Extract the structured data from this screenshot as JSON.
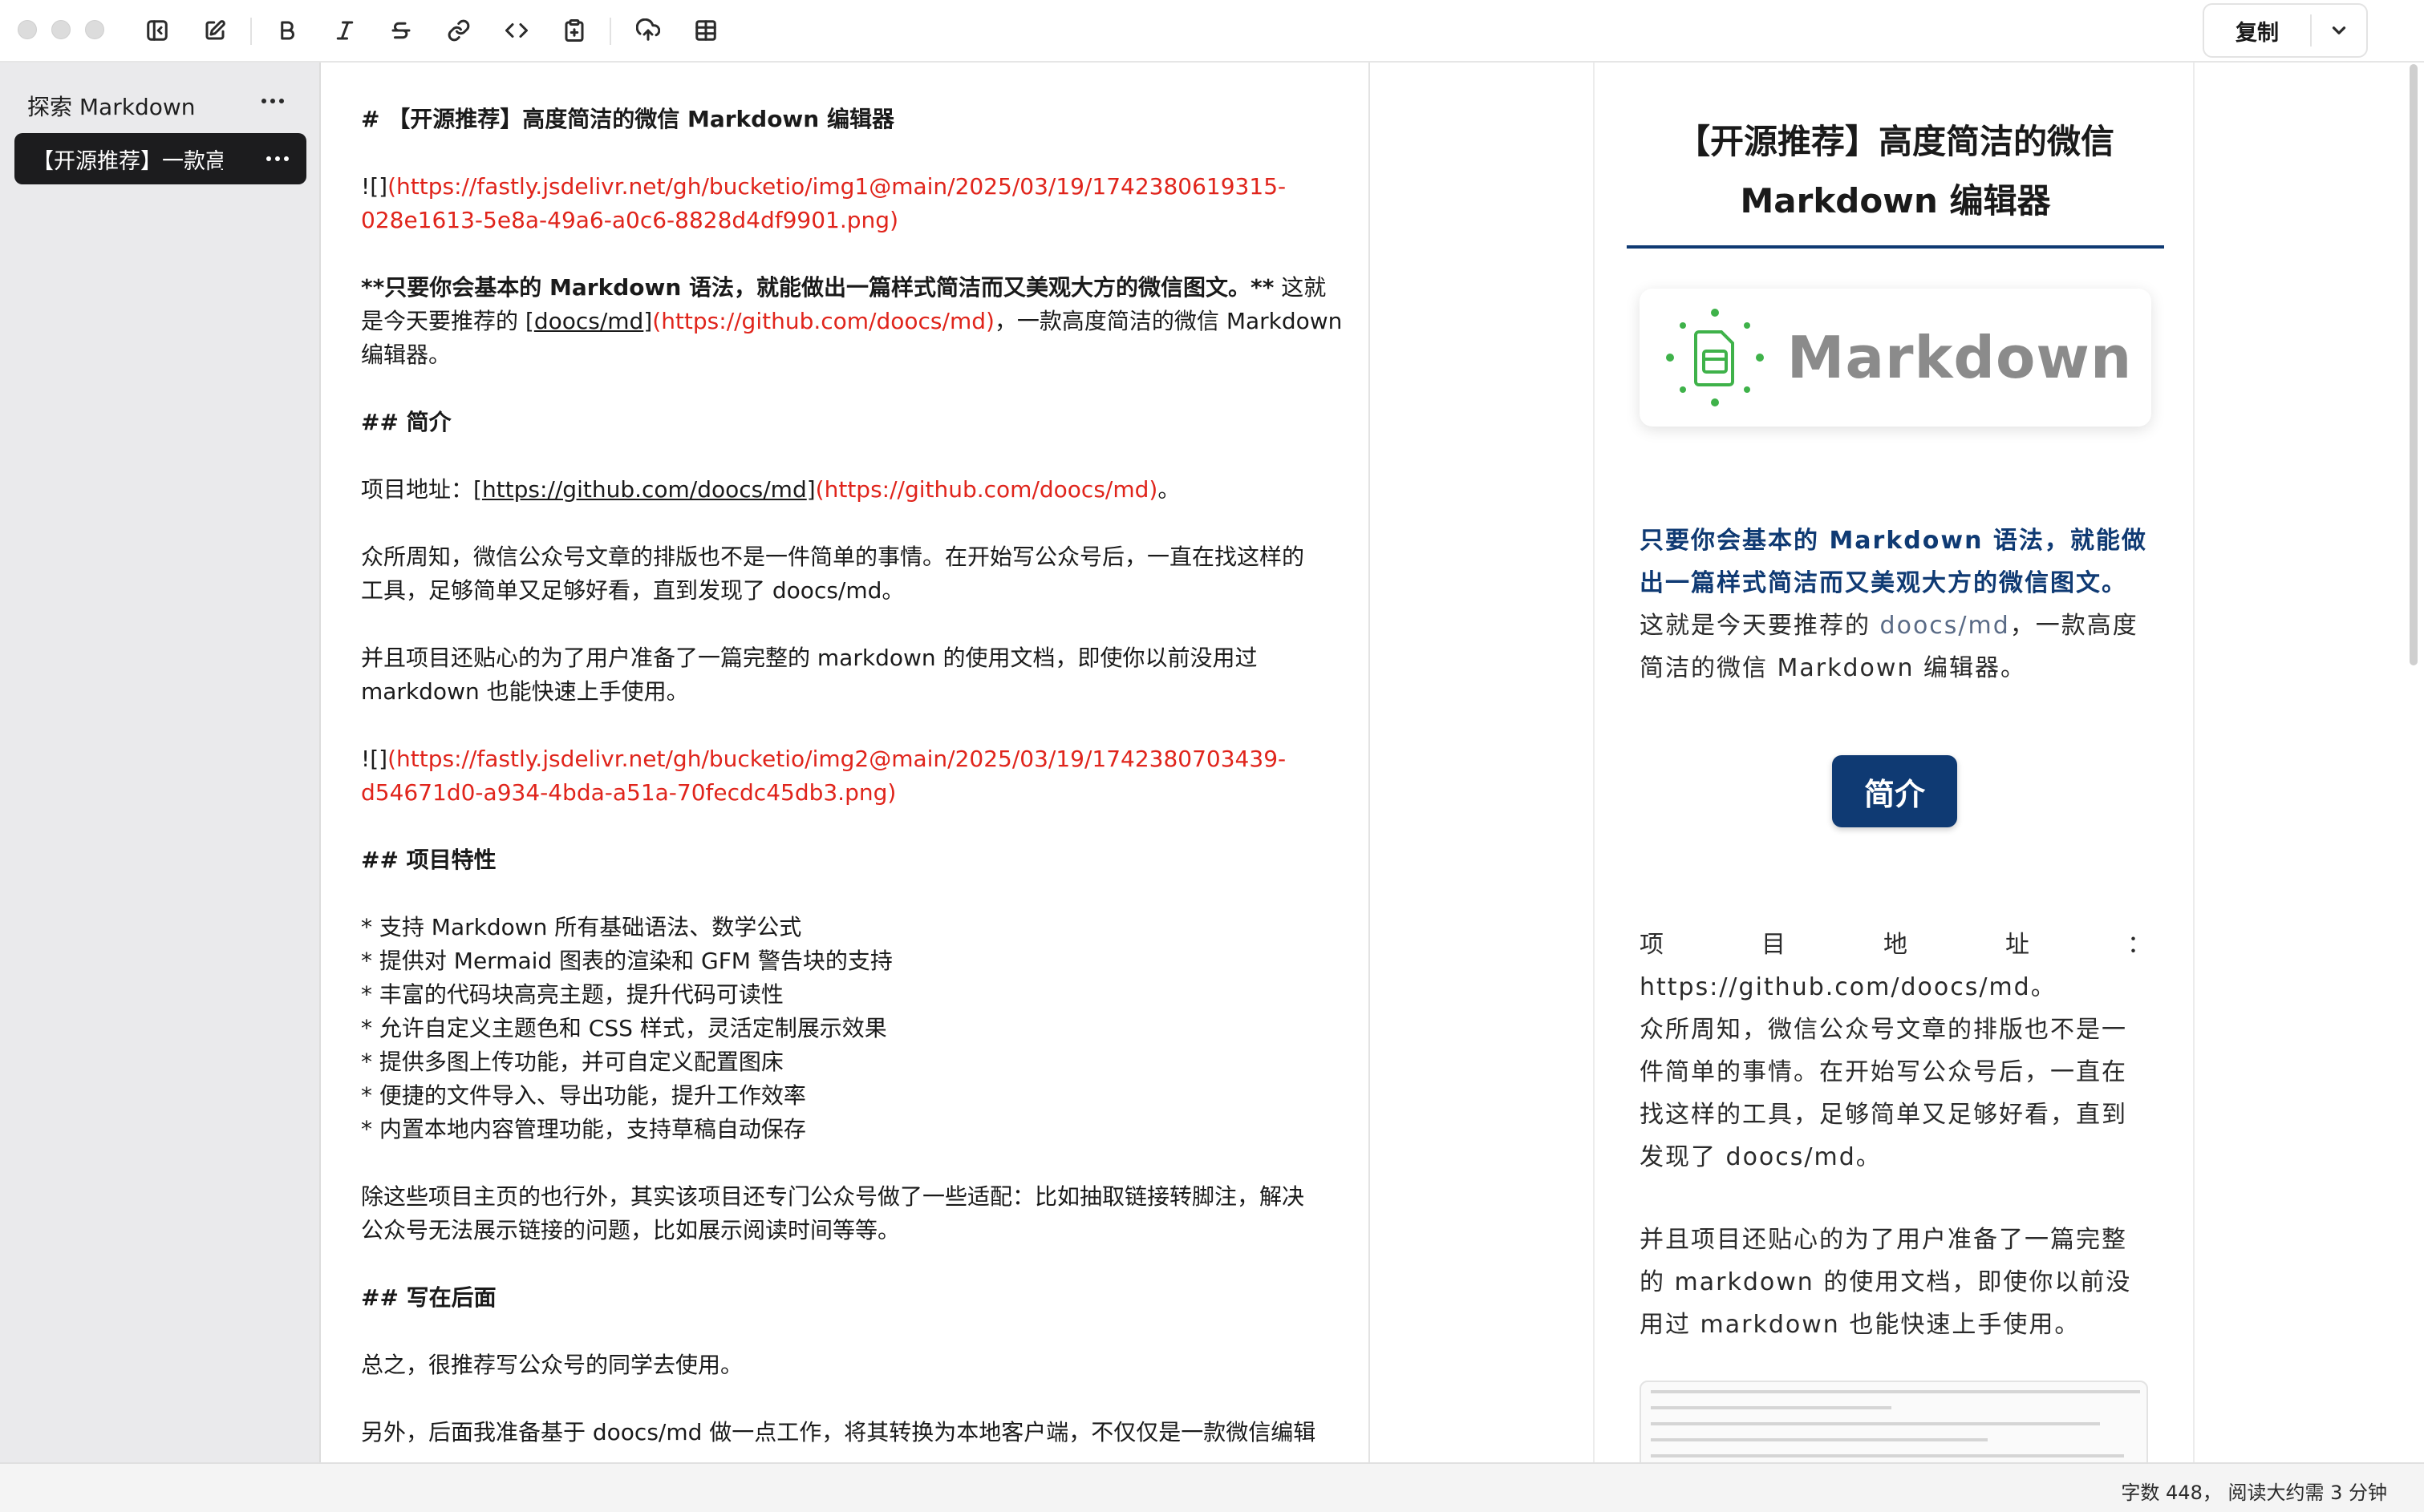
{
  "toolbar": {
    "icons": [
      "sidebar-toggle-icon",
      "edit-icon",
      "bold-icon",
      "italic-icon",
      "strikethrough-icon",
      "link-icon",
      "code-icon",
      "clipboard-icon",
      "upload-icon",
      "table-icon"
    ],
    "copy_label": "复制"
  },
  "sidebar": {
    "header": "探索 Markdown",
    "items": [
      {
        "label": "【开源推荐】一款高"
      }
    ]
  },
  "editor": {
    "h1": "# 【开源推荐】高度简洁的微信 Markdown 编辑器",
    "img1_prefix": "![]",
    "img1_url_a": "(https://fastly.jsdelivr.net/gh/bucketio/img1@main/2025/03/19/1742380619315-",
    "img1_url_b": "028e1613-5e8a-49a6-a0c6-8828d4df9901.png)",
    "p1_bold": "**只要你会基本的 Markdown 语法，就能做出一篇样式简洁而又美观大方的微信图文。**",
    "p1_rest_a": " 这就",
    "p1_b_pre": "是今天要推荐的 [",
    "p1_b_linktext": "doocs/md",
    "p1_b_mid": "]",
    "p1_b_url": "(https://github.com/doocs/md)",
    "p1_b_post": "，一款高度简洁的微信 Markdown",
    "p1_c": "编辑器。",
    "h2_intro": "## 简介",
    "addr_pre": "项目地址：[",
    "addr_linktext": "https://github.com/doocs/md",
    "addr_mid": "]",
    "addr_url": "(https://github.com/doocs/md)",
    "addr_post": "。",
    "p2_a": "众所周知，微信公众号文章的排版也不是一件简单的事情。在开始写公众号后，一直在找这样的",
    "p2_b": "工具，足够简单又足够好看，直到发现了 doocs/md。",
    "p3_a": "并且项目还贴心的为了用户准备了一篇完整的 markdown 的使用文档，即使你以前没用过",
    "p3_b": "markdown 也能快速上手使用。",
    "img2_prefix": "![]",
    "img2_url_a": "(https://fastly.jsdelivr.net/gh/bucketio/img2@main/2025/03/19/1742380703439-",
    "img2_url_b": "d54671d0-a934-4bda-a51a-70fecdc45db3.png)",
    "h2_features": "## 项目特性",
    "features": [
      "* 支持 Markdown 所有基础语法、数学公式",
      "* 提供对 Mermaid 图表的渲染和 GFM 警告块的支持",
      "* 丰富的代码块高亮主题，提升代码可读性",
      "* 允许自定义主题色和 CSS 样式，灵活定制展示效果",
      "* 提供多图上传功能，并可自定义配置图床",
      "* 便捷的文件导入、导出功能，提升工作效率",
      "* 内置本地内容管理功能，支持草稿自动保存"
    ],
    "p4_a": "除这些项目主页的也行外，其实该项目还专门公众号做了一些适配：比如抽取链接转脚注，解决",
    "p4_b": "公众号无法展示链接的问题，比如展示阅读时间等等。",
    "h2_end": "## 写在后面",
    "p5": "总之，很推荐写公众号的同学去使用。",
    "p6_partial": "另外，后面我准备基于 doocs/md 做一点工作，将其转换为本地客户端，不仅仅是一款微信编辑"
  },
  "preview": {
    "title_line1": "【开源推荐】高度简洁的微信",
    "title_line2": "Markdown 编辑器",
    "card_text": "Markdown",
    "strong_a": "只要你会基本的 Markdown 语法，就能做",
    "strong_b": "出一篇样式简洁而又美观大方的微信图文。",
    "p1_a_pre": "这就是今天要推荐的 ",
    "p1_a_link": "doocs/md",
    "p1_a_post": "，一款高度",
    "p1_b": "简洁的微信 Markdown 编辑器。",
    "intro_badge": "简介",
    "addr_chars": [
      "项",
      "目",
      "地",
      "址",
      "："
    ],
    "addr_url": "https://github.com/doocs/md。",
    "p2": [
      "众所周知，微信公众号文章的排版也不是一",
      "件简单的事情。在开始写公众号后，一直在",
      "找这样的工具，足够简单又足够好看，直到",
      "发现了 doocs/md。"
    ],
    "p3": [
      "并且项目还贴心的为了用户准备了一篇完整",
      "的 markdown 的使用文档，即使你以前没",
      "用过 markdown 也能快速上手使用。"
    ],
    "accent_color": "#0f3a73"
  },
  "status": {
    "text": "字数 448， 阅读大约需 3 分钟"
  }
}
